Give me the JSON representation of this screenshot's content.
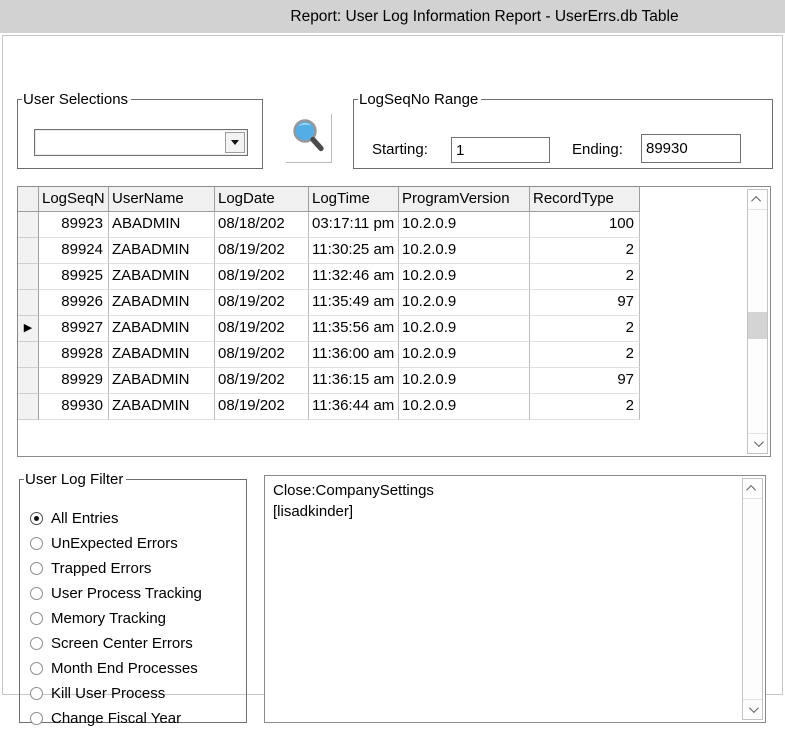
{
  "window": {
    "title": "Report: User Log Information Report - UserErrs.db Table"
  },
  "user_selections": {
    "label": "User Selections",
    "combo_value": ""
  },
  "search": {
    "icon": "magnifier",
    "lens_color": "#54aee6",
    "handle_color": "#4a4a4a"
  },
  "logseqno_range": {
    "label": "LogSeqNo Range",
    "starting_label": "Starting:",
    "starting_value": "1",
    "ending_label": "Ending:",
    "ending_value": "89930"
  },
  "log_table": {
    "columns": [
      "LogSeqN",
      "UserName",
      "LogDate",
      "LogTime",
      "ProgramVersion",
      "RecordType"
    ],
    "rows": [
      [
        "89923",
        "ABADMIN",
        "08/18/202",
        "03:17:11 pm",
        "10.2.0.9",
        "100"
      ],
      [
        "89924",
        "ZABADMIN",
        "08/19/202",
        "11:30:25 am",
        "10.2.0.9",
        "2"
      ],
      [
        "89925",
        "ZABADMIN",
        "08/19/202",
        "11:32:46 am",
        "10.2.0.9",
        "2"
      ],
      [
        "89926",
        "ZABADMIN",
        "08/19/202",
        "11:35:49 am",
        "10.2.0.9",
        "97"
      ],
      [
        "89927",
        "ZABADMIN",
        "08/19/202",
        "11:35:56 am",
        "10.2.0.9",
        "2"
      ],
      [
        "89928",
        "ZABADMIN",
        "08/19/202",
        "11:36:00 am",
        "10.2.0.9",
        "2"
      ],
      [
        "89929",
        "ZABADMIN",
        "08/19/202",
        "11:36:15 am",
        "10.2.0.9",
        "97"
      ],
      [
        "89930",
        "ZABADMIN",
        "08/19/202",
        "11:36:44 am",
        "10.2.0.9",
        "2"
      ]
    ],
    "selected_row": 4,
    "row_indicator": "▶"
  },
  "user_log_filter": {
    "label": "User Log Filter",
    "selected_index": 0,
    "options": [
      "All Entries",
      "UnExpected Errors",
      "Trapped Errors",
      "User Process Tracking",
      "Memory Tracking",
      "Screen Center Errors",
      "Month End Processes",
      "Kill User Process",
      "Change Fiscal Year"
    ]
  },
  "log_detail": {
    "lines": [
      "Close:CompanySettings",
      "[lisadkinder]"
    ]
  },
  "colors": {
    "titlebar_bg": "#d2d2d2",
    "grid_header_bg": "#f0f0f0",
    "scroll_thumb": "#d4d4d4"
  }
}
